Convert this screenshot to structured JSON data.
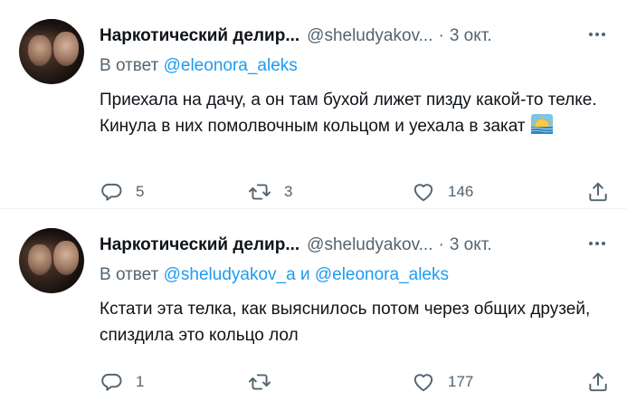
{
  "tweets": [
    {
      "author_name": "Наркотический делир...",
      "handle": "@sheludyakov...",
      "dot": "·",
      "date": "3 окт.",
      "reply_prefix": "В ответ",
      "reply_links": [
        "@eleonora_aleks"
      ],
      "reply_joiner": "",
      "text": "Приехала на дачу, а он там бухой лижет пизду какой-то телке. Кинула в них помолвочным кольцом и уехала в закат",
      "has_sunset_emoji": true,
      "replies": "5",
      "retweets": "3",
      "likes": "146"
    },
    {
      "author_name": "Наркотический делир...",
      "handle": "@sheludyakov...",
      "dot": "·",
      "date": "3 окт.",
      "reply_prefix": "В ответ",
      "reply_links": [
        "@sheludyakov_a",
        "@eleonora_aleks"
      ],
      "reply_joiner": "и",
      "text": "Кстати эта телка, как выяснилось потом через общих друзей, спиздила это кольцо лол",
      "has_sunset_emoji": false,
      "replies": "1",
      "retweets": "",
      "likes": "177"
    }
  ],
  "icons": {
    "more": "more-horizontal-icon",
    "reply": "reply-bubble-icon",
    "retweet": "retweet-icon",
    "like": "heart-icon",
    "share": "share-upload-icon",
    "emoji": "sunset-emoji-icon"
  },
  "colors": {
    "link": "#1d9bf0",
    "secondary_text": "#536471",
    "primary_text": "#0f1419"
  }
}
